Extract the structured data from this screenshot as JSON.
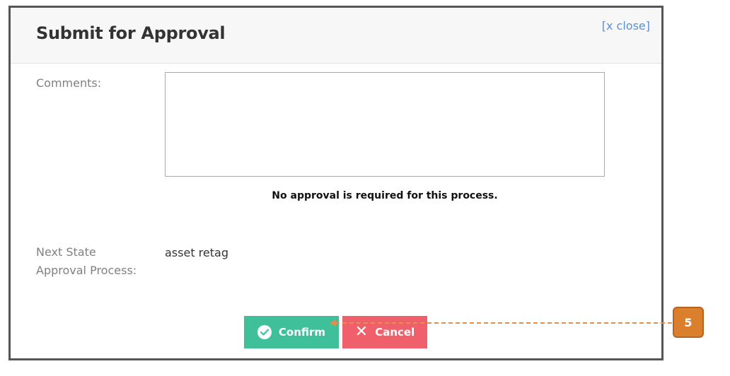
{
  "dialog": {
    "title": "Submit for Approval",
    "close_label": "[x close]"
  },
  "form": {
    "comments_label": "Comments:",
    "comments_value": "",
    "notice": "No approval is required for this process.",
    "next_state_label_line1": "Next State",
    "next_state_label_line2": "Approval Process:",
    "next_state_value": "asset retag"
  },
  "actions": {
    "confirm_label": "Confirm",
    "cancel_label": "Cancel"
  },
  "callout": {
    "number": "5"
  },
  "colors": {
    "confirm": "#3fbf9a",
    "cancel": "#f0606a",
    "link": "#5b8fd3",
    "callout": "#d97f2e"
  },
  "icons": {
    "confirm": "check-circle-icon",
    "cancel": "x-icon"
  }
}
